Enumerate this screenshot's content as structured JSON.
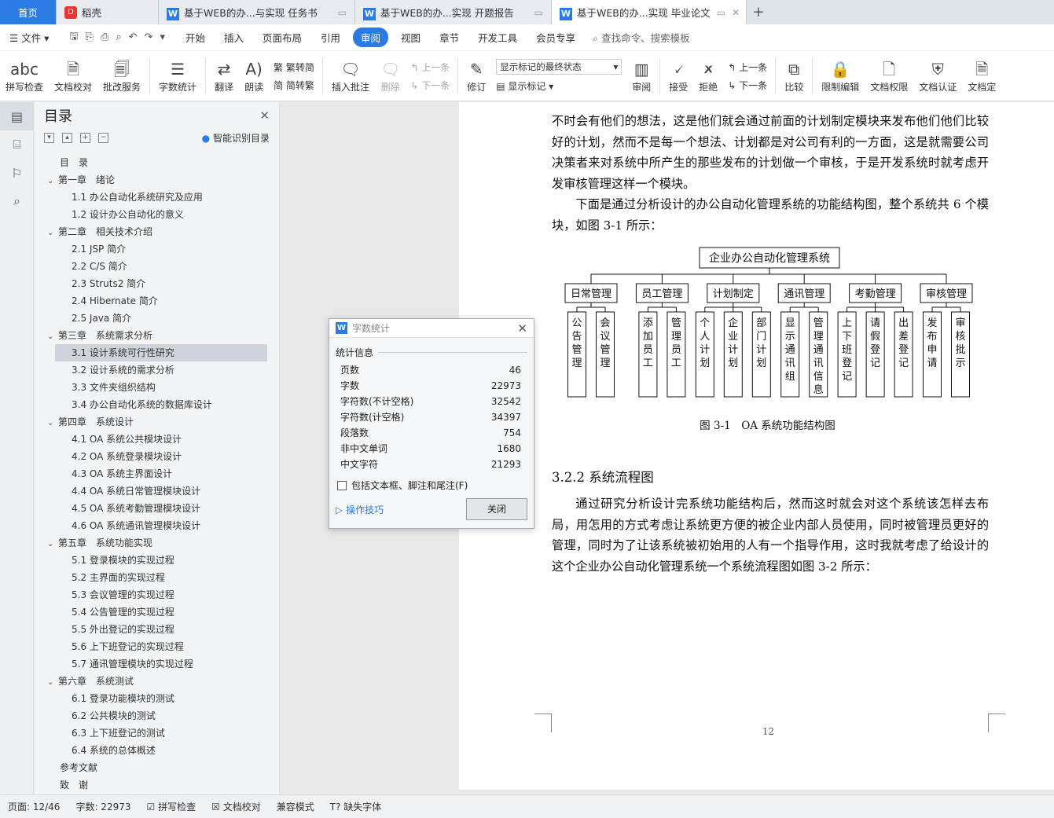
{
  "tabs": {
    "home": "首页",
    "daoke": "稻壳",
    "doc1": "基于WEB的办...与实现 任务书",
    "doc2": "基于WEB的办...实现 开题报告",
    "doc3": "基于WEB的办...实现 毕业论文"
  },
  "menu": {
    "file": "文件",
    "items": [
      "开始",
      "插入",
      "页面布局",
      "引用",
      "审阅",
      "视图",
      "章节",
      "开发工具",
      "会员专享"
    ],
    "active": "审阅",
    "search": "查找命令、搜索模板"
  },
  "ribbon": {
    "spell": "拼写检查",
    "proof": "文档校对",
    "revise_service": "批改服务",
    "word_count": "字数统计",
    "translate": "翻译",
    "read": "朗读",
    "trad": "繁转简",
    "simp": "简转繁",
    "insert_comment": "插入批注",
    "delete": "删除",
    "prev": "上一条",
    "next": "下一条",
    "revise": "修订",
    "markup_state": "显示标记的最终状态",
    "show_markup": "显示标记",
    "review": "审阅",
    "accept": "接受",
    "reject": "拒绝",
    "prev2": "上一条",
    "next2": "下一条",
    "compare": "比较",
    "restrict": "限制编辑",
    "permission": "文档权限",
    "certify": "文档认证",
    "more": "文档定"
  },
  "toc": {
    "title": "目录",
    "smart": "智能识别目录",
    "items": [
      {
        "level": 0,
        "text": "目　录"
      },
      {
        "level": 1,
        "text": "第一章　绪论"
      },
      {
        "level": 2,
        "text": "1.1  办公自动化系统研究及应用"
      },
      {
        "level": 2,
        "text": "1.2  设计办公自动化的意义"
      },
      {
        "level": 1,
        "text": "第二章　相关技术介绍"
      },
      {
        "level": 2,
        "text": "2.1 JSP 简介"
      },
      {
        "level": 2,
        "text": "2.2 C/S 简介"
      },
      {
        "level": 2,
        "text": "2.3 Struts2 简介"
      },
      {
        "level": 2,
        "text": "2.4 Hibernate 简介"
      },
      {
        "level": 2,
        "text": "2.5 Java 简介"
      },
      {
        "level": 1,
        "text": "第三章　系统需求分析"
      },
      {
        "level": 2,
        "text": "3.1  设计系统可行性研究",
        "active": true
      },
      {
        "level": 2,
        "text": "3.2  设计系统的需求分析"
      },
      {
        "level": 2,
        "text": "3.3  文件夹组织结构"
      },
      {
        "level": 2,
        "text": "3.4  办公自动化系统的数据库设计"
      },
      {
        "level": 1,
        "text": "第四章　系统设计"
      },
      {
        "level": 2,
        "text": "4.1 OA 系统公共模块设计"
      },
      {
        "level": 2,
        "text": "4.2 OA 系统登录模块设计"
      },
      {
        "level": 2,
        "text": "4.3 OA 系统主界面设计"
      },
      {
        "level": 2,
        "text": "4.4 OA 系统日常管理模块设计"
      },
      {
        "level": 2,
        "text": "4.5 OA 系统考勤管理模块设计"
      },
      {
        "level": 2,
        "text": "4.6 OA 系统通讯管理模块设计"
      },
      {
        "level": 1,
        "text": "第五章　系统功能实现"
      },
      {
        "level": 2,
        "text": "5.1  登录模块的实现过程"
      },
      {
        "level": 2,
        "text": "5.2  主界面的实现过程"
      },
      {
        "level": 2,
        "text": "5.3  会议管理的实现过程"
      },
      {
        "level": 2,
        "text": "5.4  公告管理的实现过程"
      },
      {
        "level": 2,
        "text": "5.5  外出登记的实现过程"
      },
      {
        "level": 2,
        "text": "5.6  上下班登记的实现过程"
      },
      {
        "level": 2,
        "text": "5.7  通讯管理模块的实现过程"
      },
      {
        "level": 1,
        "text": "第六章　系统测试"
      },
      {
        "level": 2,
        "text": "6.1  登录功能模块的测试"
      },
      {
        "level": 2,
        "text": "6.2  公共模块的测试"
      },
      {
        "level": 2,
        "text": "6.3  上下班登记的测试"
      },
      {
        "level": 2,
        "text": "6.4  系统的总体概述"
      },
      {
        "level": 0,
        "text": "参考文献"
      },
      {
        "level": 0,
        "text": "致　谢"
      }
    ]
  },
  "doc": {
    "p1": "不时会有他们的想法，这是他们就会通过前面的计划制定模块来发布他们他们比较好的计划，然而不是每一个想法、计划都是对公司有利的一方面，这是就需要公司决策者来对系统中所产生的那些发布的计划做一个审核，于是开发系统时就考虑开发审核管理这样一个模块。",
    "p2": "下面是通过分析设计的办公自动化管理系统的功能结构图，整个系统共 6 个模块，如图 3-1 所示：",
    "diagram": {
      "root": "企业办公自动化管理系统",
      "modules": [
        {
          "name": "日常管理",
          "children": [
            "公告管理",
            "会议管理"
          ]
        },
        {
          "name": "员工管理",
          "children": [
            "添加员工",
            "管理员工"
          ]
        },
        {
          "name": "计划制定",
          "children": [
            "个人计划",
            "企业计划",
            "部门计划"
          ]
        },
        {
          "name": "通讯管理",
          "children": [
            "显示通讯组",
            "管理通讯信息"
          ]
        },
        {
          "name": "考勤管理",
          "children": [
            "上下班登记",
            "请假登记",
            "出差登记"
          ]
        },
        {
          "name": "审核管理",
          "children": [
            "发布申请",
            "审核批示"
          ]
        }
      ]
    },
    "fig_caption": "图 3-1　OA 系统功能结构图",
    "section": "3.2.2  系统流程图",
    "p3": "通过研究分析设计完系统功能结构后，然而这时就会对这个系统该怎样去布局，用怎用的方式考虑让系统更方便的被企业内部人员使用，同时被管理员更好的管理，同时为了让该系统被初始用的人有一个指导作用，这时我就考虑了给设计的这个企业办公自动化管理系统一个系统流程图如图 3-2 所示：",
    "page_number": "12"
  },
  "dialog": {
    "title": "字数统计",
    "section": "统计信息",
    "rows": [
      {
        "label": "页数",
        "value": "46"
      },
      {
        "label": "字数",
        "value": "22973"
      },
      {
        "label": "字符数(不计空格)",
        "value": "32542"
      },
      {
        "label": "字符数(计空格)",
        "value": "34397"
      },
      {
        "label": "段落数",
        "value": "754"
      },
      {
        "label": "非中文单词",
        "value": "1680"
      },
      {
        "label": "中文字符",
        "value": "21293"
      }
    ],
    "include": "包括文本框、脚注和尾注(F)",
    "tips": "操作技巧",
    "close": "关闭"
  },
  "status": {
    "page": "页面: 12/46",
    "words": "字数: 22973",
    "spell": "拼写检查",
    "proof": "文档校对",
    "compat": "兼容模式",
    "missing_font": "缺失字体"
  }
}
